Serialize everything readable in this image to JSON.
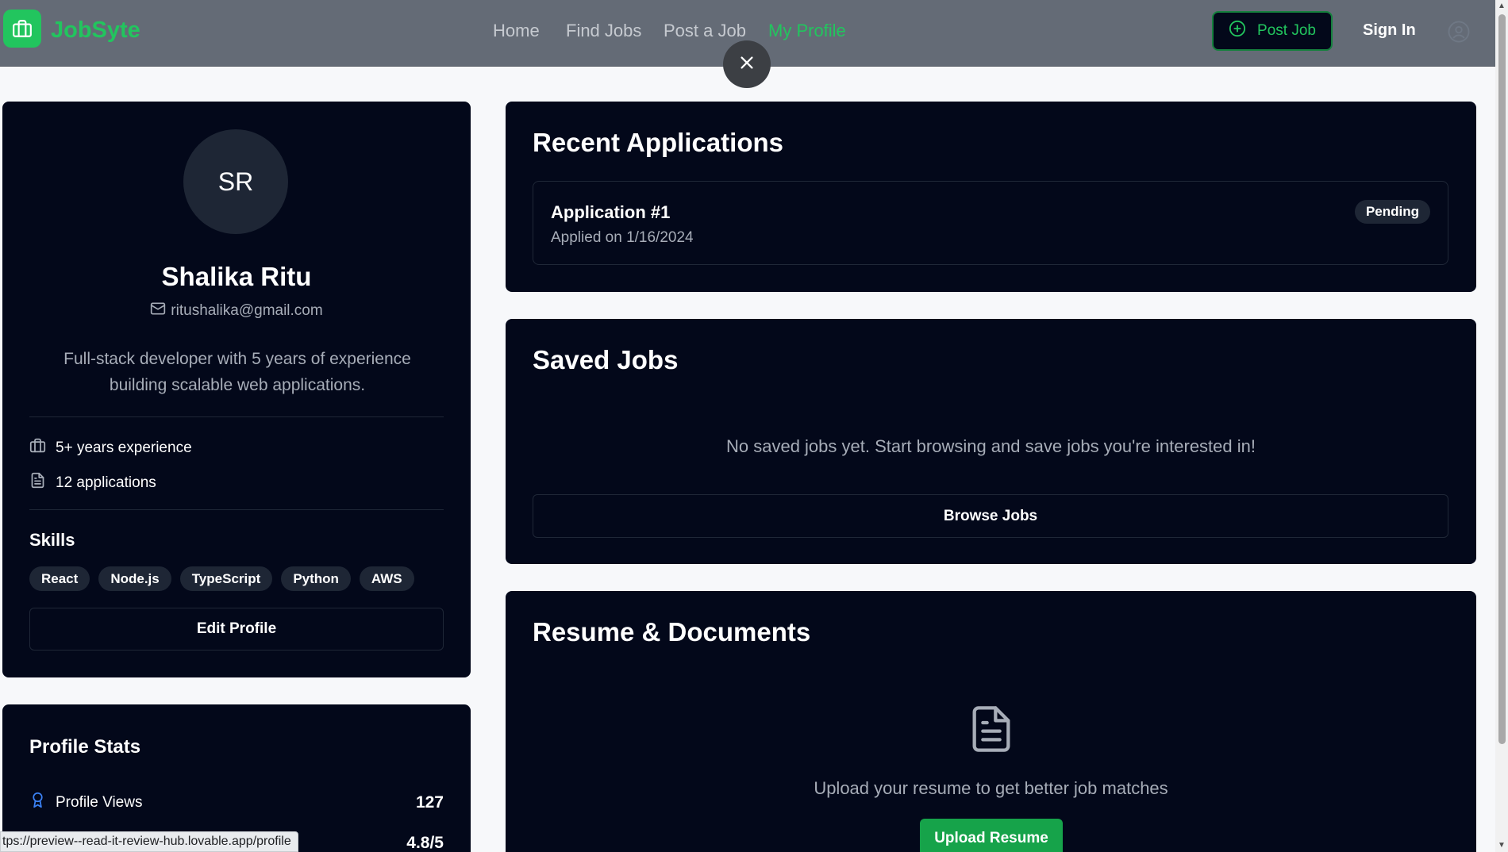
{
  "header": {
    "brand": "JobSyte",
    "nav": [
      {
        "label": "Home"
      },
      {
        "label": "Find Jobs"
      },
      {
        "label": "Post a Job"
      },
      {
        "label": "My Profile",
        "active": true
      }
    ],
    "post_job_label": "Post Job",
    "sign_in_label": "Sign In"
  },
  "profile": {
    "initials": "SR",
    "name": "Shalika Ritu",
    "email": "ritushalika@gmail.com",
    "bio": "Full-stack developer with 5 years of experience building scalable web applications.",
    "experience": "5+ years experience",
    "applications": "12 applications",
    "skills_heading": "Skills",
    "skills": [
      "React",
      "Node.js",
      "TypeScript",
      "Python",
      "AWS"
    ],
    "edit_label": "Edit Profile"
  },
  "stats": {
    "title": "Profile Stats",
    "items": [
      {
        "label": "Profile Views",
        "value": "127"
      },
      {
        "label": "",
        "value": "4.8/5"
      }
    ]
  },
  "recent_applications": {
    "title": "Recent Applications",
    "items": [
      {
        "title": "Application #1",
        "date": "Applied on 1/16/2024",
        "status": "Pending"
      }
    ]
  },
  "saved_jobs": {
    "title": "Saved Jobs",
    "empty_text": "No saved jobs yet. Start browsing and save jobs you're interested in!",
    "browse_label": "Browse Jobs"
  },
  "resume": {
    "title": "Resume & Documents",
    "text": "Upload your resume to get better job matches",
    "upload_label": "Upload Resume"
  },
  "status_bar": {
    "url": "tps://preview--read-it-review-hub.lovable.app/profile"
  },
  "colors": {
    "brand": "#22c55e",
    "card_bg": "#03081a",
    "header_bg": "#646b76"
  }
}
